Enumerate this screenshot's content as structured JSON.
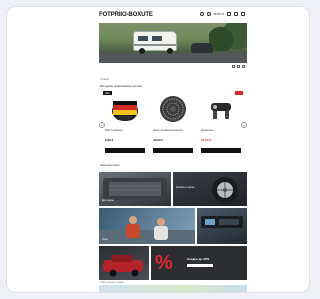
{
  "header": {
    "logo": "FOTPRIIO-BOXUTE",
    "account_label": "ВОЙТИ",
    "icons": [
      "search-icon",
      "user-icon",
      "heart-icon",
      "cart-icon",
      "menu-icon"
    ]
  },
  "hero": {
    "alt": "camper-van-on-road"
  },
  "nav": {
    "breadcrumb": "Главная",
    "section_title": "Выгодные предложения для вас"
  },
  "products": [
    {
      "name": "Флаг Германии",
      "price": "9,99 €",
      "badge": "NEU"
    },
    {
      "name": "Цепи противоскольжения",
      "price": "49,90 €",
      "badge": ""
    },
    {
      "name": "Держатель",
      "price": "29,90 €",
      "badge": "%"
    }
  ],
  "section2": {
    "title": "Наши категории"
  },
  "tiles": [
    {
      "title": "Для зимы",
      "cta": ""
    },
    {
      "title": "Колёса и шины",
      "cta": ""
    },
    {
      "title": "Уход",
      "cta": ""
    },
    {
      "title": "",
      "cta": ""
    },
    {
      "title": "",
      "cta": ""
    },
    {
      "title": "Скидки до 30%",
      "cta": ""
    }
  ],
  "footer": {
    "map_label": "Найти магазин рядом"
  },
  "colors": {
    "accent_red": "#e0262f",
    "dark": "#111111"
  }
}
